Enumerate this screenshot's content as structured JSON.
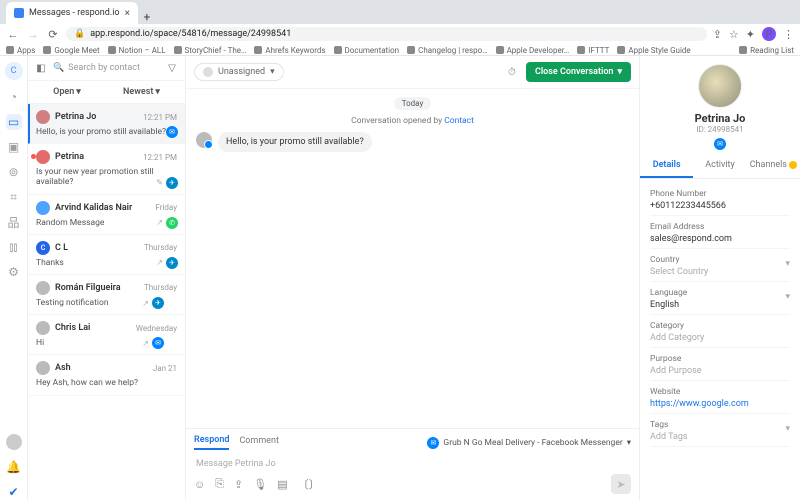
{
  "browser": {
    "tab_title": "Messages - respond.io",
    "url": "app.respond.io/space/54816/message/24998541",
    "bookmarks": [
      "Apps",
      "Google Meet",
      "Notion – ALL",
      "StoryChief - The…",
      "Ahrefs Keywords",
      "Documentation",
      "Changelog | respo…",
      "Apple Developer…",
      "IFTTT",
      "Apple Style Guide"
    ],
    "reading_list": "Reading List"
  },
  "filters": {
    "open": "Open",
    "newest": "Newest"
  },
  "search": {
    "placeholder": "Search by contact"
  },
  "assign": {
    "label": "Unassigned"
  },
  "close": {
    "label": "Close Conversation"
  },
  "date_pill": "Today",
  "sys_opened_prefix": "Conversation opened by ",
  "sys_opened_link": "Contact",
  "conversations": [
    {
      "name": "Petrina Jo",
      "time": "12:21 PM",
      "snippet": "Hello, is your promo still available?"
    },
    {
      "name": "Petrina",
      "time": "12:21 PM",
      "snippet": "Is your new year promotion still available?"
    },
    {
      "name": "Arvind Kalidas Nair",
      "time": "Friday",
      "snippet": "Random Message"
    },
    {
      "name": "C L",
      "time": "Thursday",
      "snippet": "Thanks"
    },
    {
      "name": "Román Filgueira",
      "time": "Thursday",
      "snippet": "Testing notification"
    },
    {
      "name": "Chris Lai",
      "time": "Wednesday",
      "snippet": "Hi"
    },
    {
      "name": "Ash",
      "time": "Jan 21",
      "snippet": "Hey Ash, how can we help?"
    }
  ],
  "message": {
    "text": "Hello, is your promo still available?"
  },
  "composer": {
    "tabs": {
      "respond": "Respond",
      "comment": "Comment"
    },
    "channel_label": "Grub N Go Meal Delivery - Facebook Messenger",
    "placeholder": "Message Petrina Jo"
  },
  "details": {
    "name": "Petrina Jo",
    "id_label": "ID: 24998541",
    "tabs": {
      "details": "Details",
      "activity": "Activity",
      "channels": "Channels"
    },
    "fields": {
      "phone": {
        "label": "Phone Number",
        "value": "+60112233445566"
      },
      "email": {
        "label": "Email Address",
        "value": "sales@respond.com"
      },
      "country": {
        "label": "Country",
        "value": "Select Country"
      },
      "language": {
        "label": "Language",
        "value": "English"
      },
      "category": {
        "label": "Category",
        "value": "Add Category"
      },
      "purpose": {
        "label": "Purpose",
        "value": "Add Purpose"
      },
      "website": {
        "label": "Website",
        "value": "https://www.google.com"
      },
      "tags": {
        "label": "Tags",
        "value": "Add Tags"
      }
    }
  }
}
